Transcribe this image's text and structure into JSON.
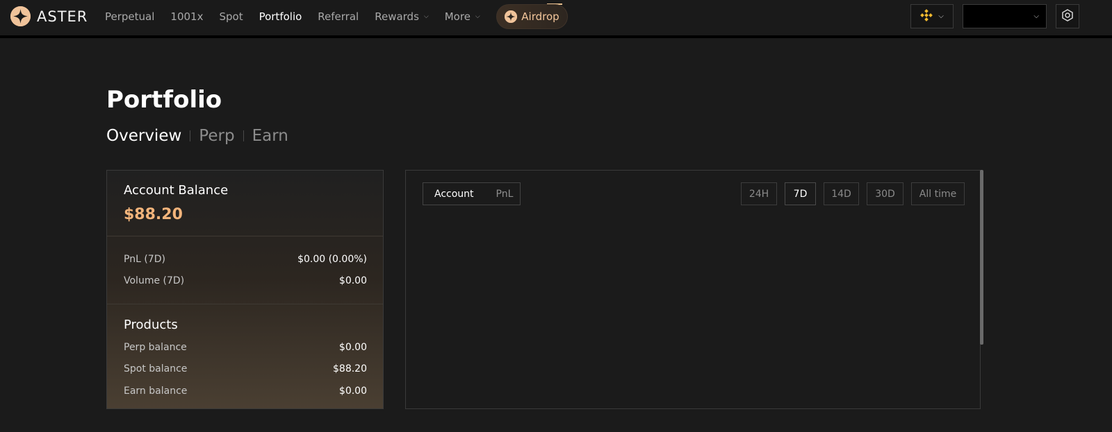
{
  "app": {
    "logo_text": "ASTER"
  },
  "nav": {
    "items": [
      {
        "label": "Perpetual",
        "active": false,
        "has_dropdown": false
      },
      {
        "label": "1001x",
        "active": false,
        "has_dropdown": false
      },
      {
        "label": "Spot",
        "active": false,
        "has_dropdown": false
      },
      {
        "label": "Portfolio",
        "active": true,
        "has_dropdown": false
      },
      {
        "label": "Referral",
        "active": false,
        "has_dropdown": false
      },
      {
        "label": "Rewards",
        "active": false,
        "has_dropdown": true
      },
      {
        "label": "More",
        "active": false,
        "has_dropdown": true
      }
    ],
    "airdrop_label": "Airdrop",
    "chain_icon": "bnb-chain-icon",
    "wallet_icon": "chevron-down-icon",
    "settings_icon": "settings-hex-icon"
  },
  "page": {
    "title": "Portfolio",
    "tabs": [
      {
        "label": "Overview",
        "active": true
      },
      {
        "label": "Perp",
        "active": false
      },
      {
        "label": "Earn",
        "active": false
      }
    ]
  },
  "summary": {
    "balance_label": "Account Balance",
    "balance_value": "$88.20",
    "stats": [
      {
        "label": "PnL (7D)",
        "value": "$0.00 (0.00%)"
      },
      {
        "label": "Volume (7D)",
        "value": "$0.00"
      }
    ],
    "products_title": "Products",
    "products": [
      {
        "label": "Perp balance",
        "value": "$0.00"
      },
      {
        "label": "Spot balance",
        "value": "$88.20"
      },
      {
        "label": "Earn balance",
        "value": "$0.00"
      }
    ]
  },
  "chart_panel": {
    "segments": [
      {
        "label": "Account",
        "active": true
      },
      {
        "label": "PnL",
        "active": false
      }
    ],
    "ranges": [
      {
        "label": "24H",
        "active": false
      },
      {
        "label": "7D",
        "active": true
      },
      {
        "label": "14D",
        "active": false
      },
      {
        "label": "30D",
        "active": false
      },
      {
        "label": "All time",
        "active": false
      }
    ]
  },
  "colors": {
    "accent": "#f2b47b",
    "background": "#1b1b1b",
    "bnb_yellow": "#f3ba2f"
  }
}
